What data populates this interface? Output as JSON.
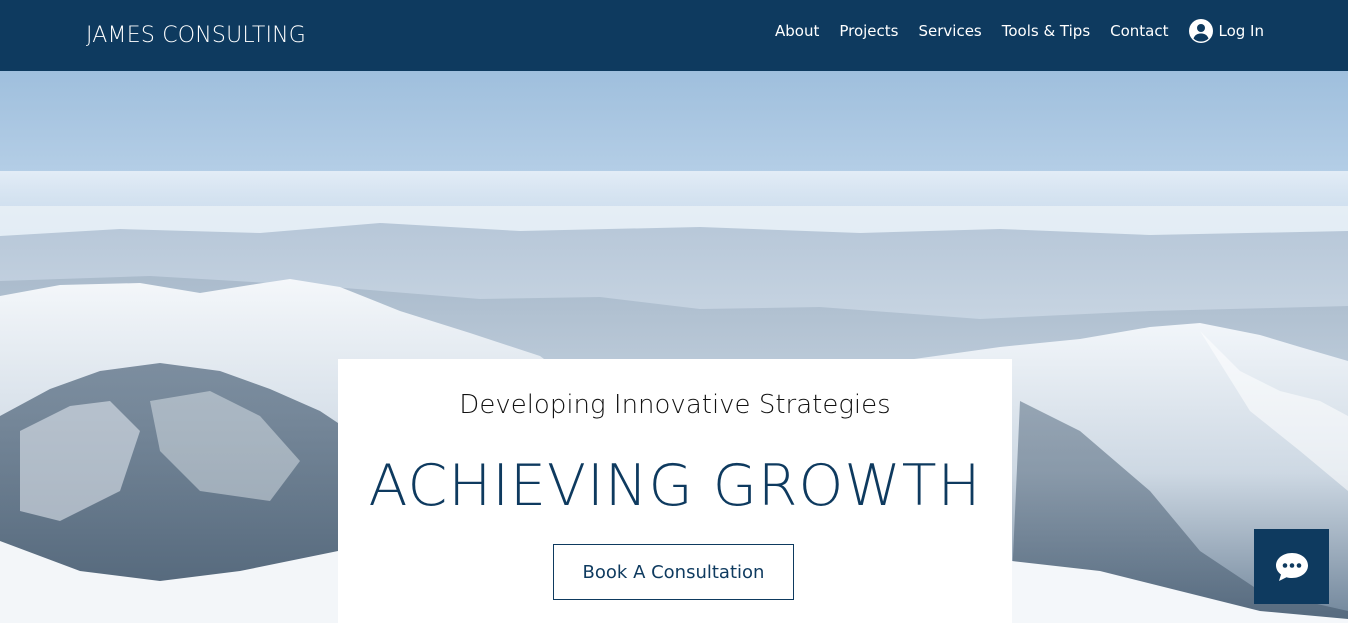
{
  "header": {
    "brand": "JAMES CONSULTING",
    "nav": [
      {
        "label": "About"
      },
      {
        "label": "Projects"
      },
      {
        "label": "Services"
      },
      {
        "label": "Tools & Tips"
      },
      {
        "label": "Contact"
      }
    ],
    "login": {
      "label": "Log In",
      "icon": "user-account-icon"
    }
  },
  "hero": {
    "background": "snowy-mountain-landscape",
    "subtitle": "Developing Innovative Strategies",
    "headline": "ACHIEVING GROWTH",
    "cta_label": "Book A Consultation"
  },
  "chat": {
    "icon": "chat-bubble-icon"
  },
  "colors": {
    "brand": "#0e3a5f",
    "card": "#ffffff",
    "text": "#111111"
  }
}
